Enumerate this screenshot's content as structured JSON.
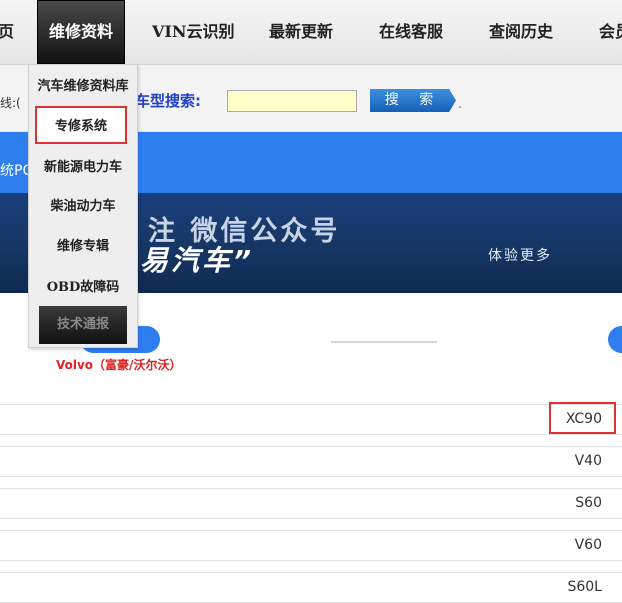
{
  "topnav": {
    "items": [
      {
        "label": "页"
      },
      {
        "label": "维修资料"
      },
      {
        "label": "VIN云识别"
      },
      {
        "label": "最新更新"
      },
      {
        "label": "在线客服"
      },
      {
        "label": "查阅历史"
      },
      {
        "label": "会员"
      }
    ]
  },
  "search": {
    "hotline": "线:(",
    "label": "车型搜索:",
    "input_value": "",
    "button_label": "搜 索",
    "trailing": "."
  },
  "bluebar": {
    "text": "统PC"
  },
  "banner": {
    "line1": "注 微信公众号",
    "line2": "易汽车”",
    "cta": "体验更多"
  },
  "brand": {
    "name": "Volvo（富豪/沃尔沃）"
  },
  "models": [
    "XC90",
    "V40",
    "S60",
    "V60",
    "S60L"
  ],
  "dropdown": {
    "items": [
      {
        "label": "汽车维修资料库"
      },
      {
        "label": "专修系统"
      },
      {
        "label": "新能源电力车"
      },
      {
        "label": "柴油动力车"
      },
      {
        "label": "维修专辑"
      },
      {
        "label": "OBD故障码"
      },
      {
        "label": "技术通报"
      }
    ]
  },
  "colors": {
    "accent_blue": "#2f7ef0",
    "highlight_red": "#e03030",
    "banner_navy": "#163664"
  }
}
